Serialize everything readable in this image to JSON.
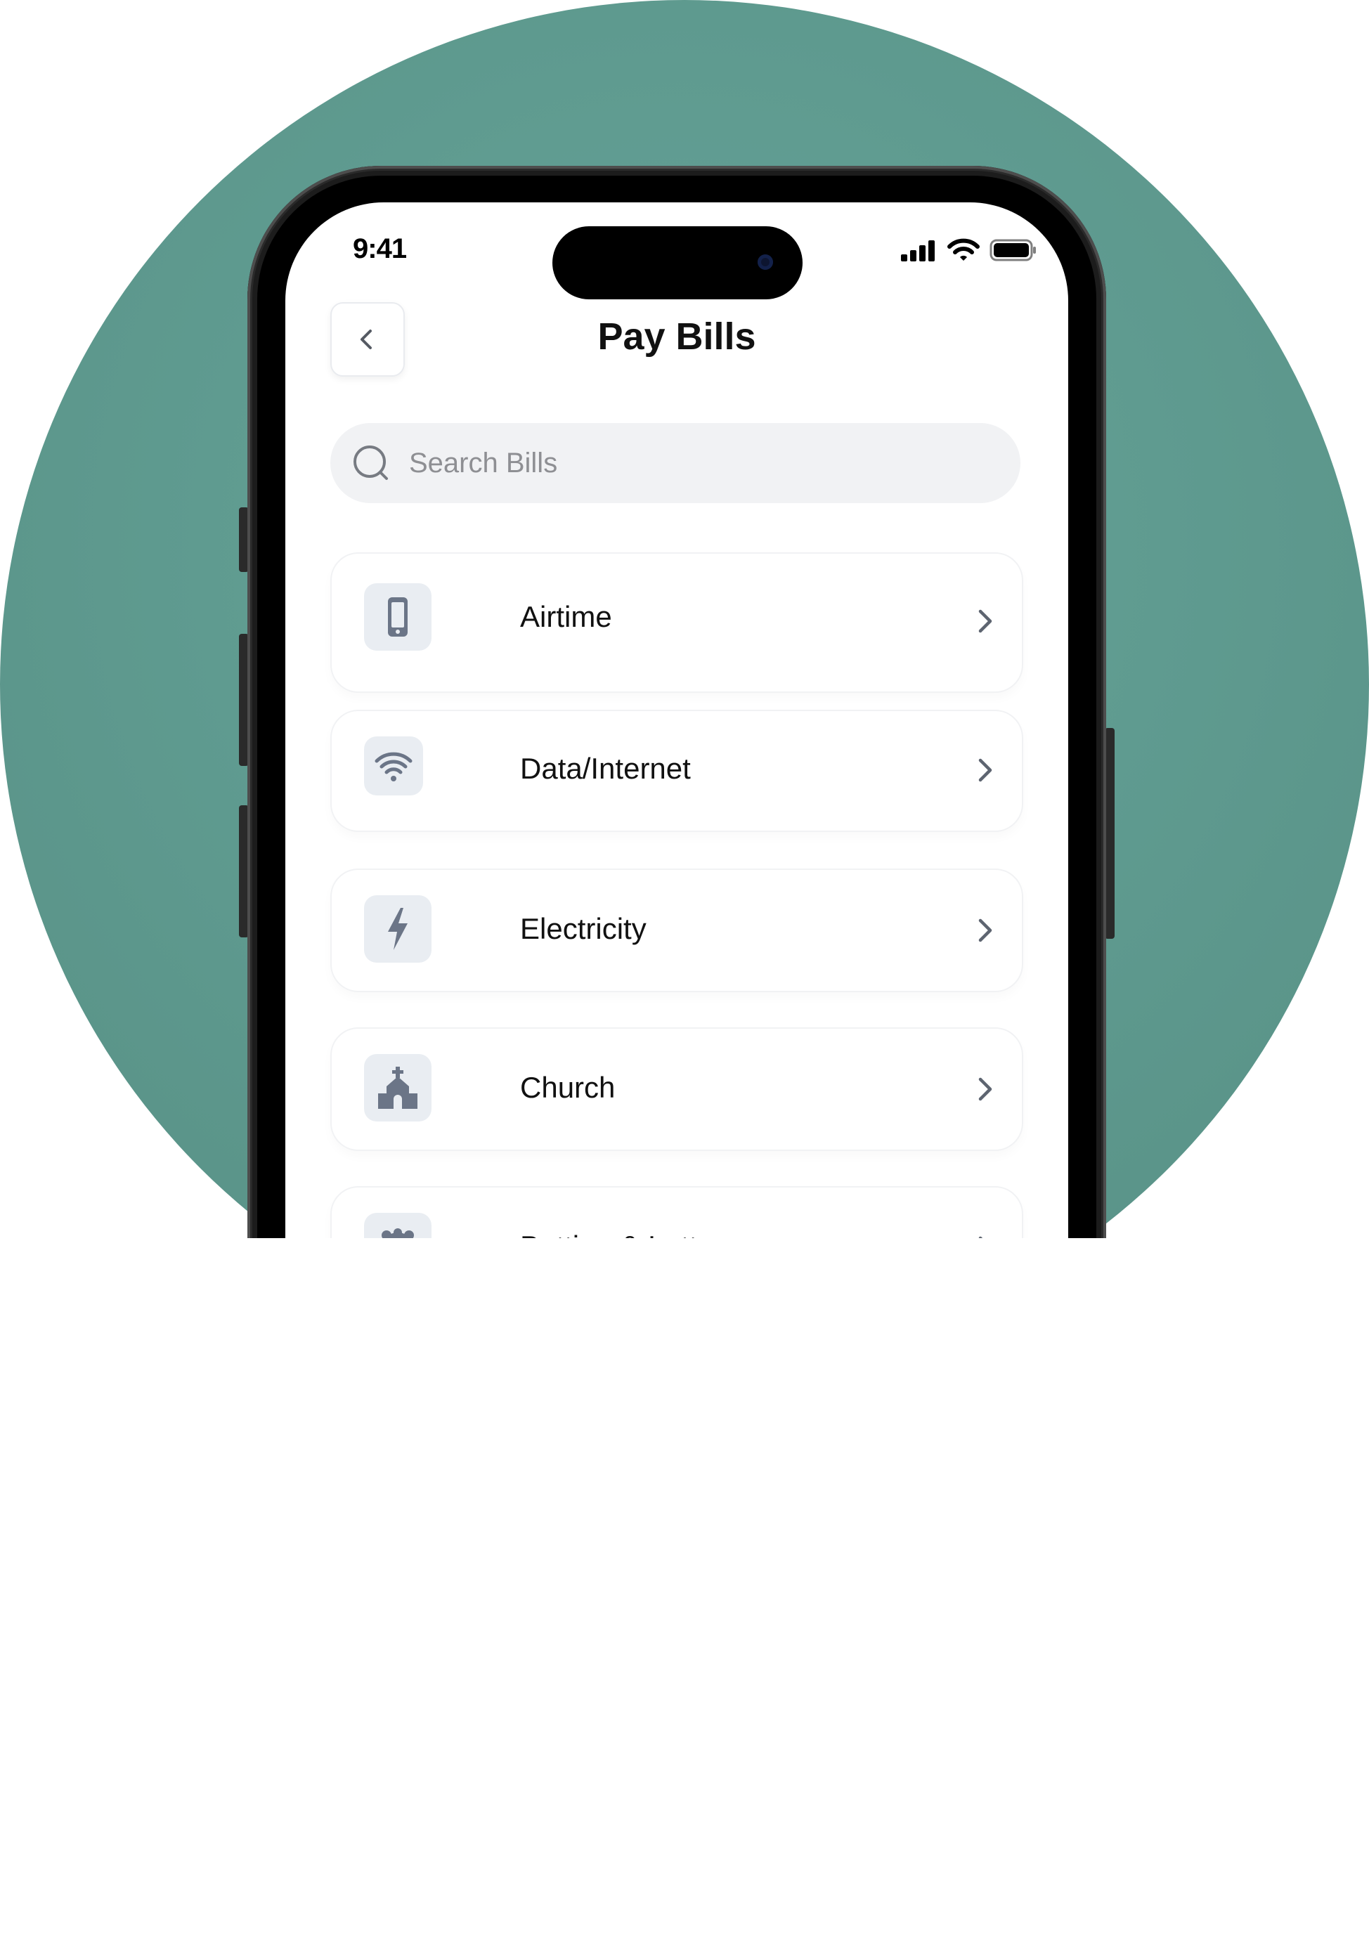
{
  "status_bar": {
    "time": "9:41"
  },
  "header": {
    "title": "Pay Bills"
  },
  "search": {
    "placeholder": "Search Bills",
    "value": ""
  },
  "bills": [
    {
      "label": "Airtime",
      "icon": "phone-icon"
    },
    {
      "label": "Data/Internet",
      "icon": "wifi-icon"
    },
    {
      "label": "Electricity",
      "icon": "lightning-icon"
    },
    {
      "label": "Church",
      "icon": "church-icon"
    },
    {
      "label": "Betting & Lottery",
      "icon": "lottery-ball-icon"
    }
  ],
  "colors": {
    "background": "#5f9b90",
    "icon_fill": "#6b7587",
    "icon_tile": "#e9edf2",
    "search_bg": "#f1f2f4"
  }
}
